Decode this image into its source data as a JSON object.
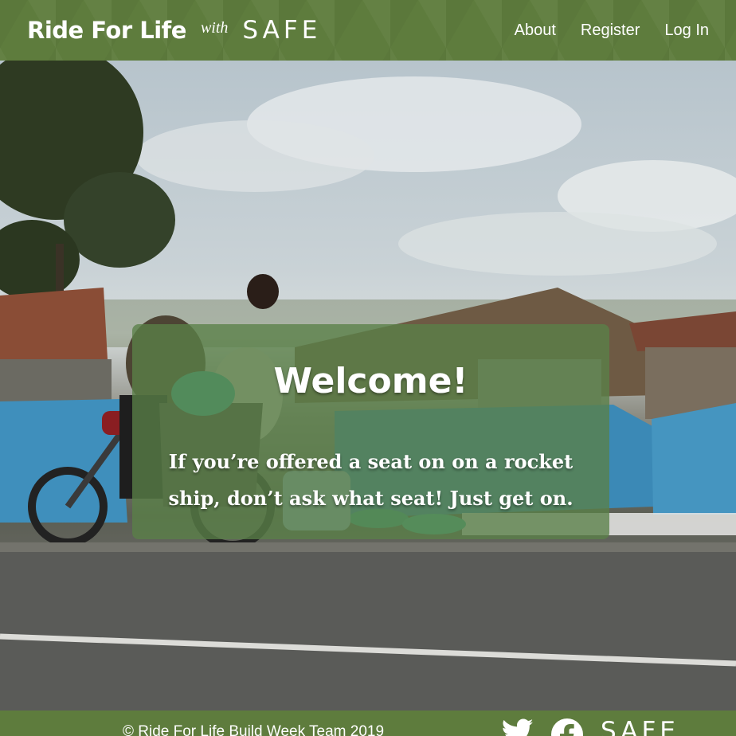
{
  "header": {
    "brand_title": "Ride For Life",
    "brand_with": "with",
    "brand_logo": "SAFE",
    "nav": [
      {
        "label": "About"
      },
      {
        "label": "Register"
      },
      {
        "label": "Log In"
      }
    ]
  },
  "card": {
    "title": "Welcome!",
    "quote": "If you’re offered a seat on on a rocket ship, don’t ask what seat! Just get on."
  },
  "footer": {
    "copyright": "© Ride For Life Build Week Team 2019",
    "icons": [
      "twitter-icon",
      "facebook-icon"
    ],
    "logo": "SAFE"
  },
  "colors": {
    "brand_green": "#5e7c3d",
    "card_overlay": "#5a8048"
  }
}
